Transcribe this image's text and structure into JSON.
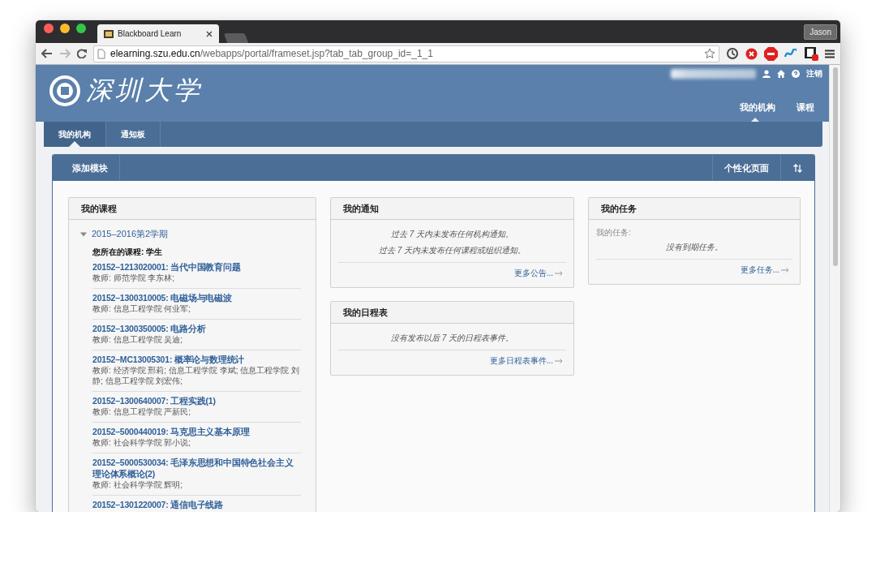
{
  "browser": {
    "tab_title": "Blackboard Learn",
    "profile": "Jason",
    "url_host": "elearning.szu.edu.cn",
    "url_path": "/webapps/portal/frameset.jsp?tab_tab_group_id=_1_1"
  },
  "header": {
    "logo_text": "深圳大学",
    "logout": "注销",
    "main_tabs": [
      {
        "label": "我的机构",
        "selected": true
      },
      {
        "label": "课程",
        "selected": false
      }
    ]
  },
  "subnav": [
    {
      "label": "我的机构",
      "selected": true
    },
    {
      "label": "通知板",
      "selected": false
    }
  ],
  "toolbar": {
    "add_module": "添加模块",
    "personalize": "个性化页面"
  },
  "my_courses": {
    "title": "我的课程",
    "term": {
      "label": "2015–2016第2学期",
      "expanded": true
    },
    "role": "您所在的课程: 学生",
    "courses": [
      {
        "title": "20152–1213020001: 当代中国教育问题",
        "teachers": "教师: 师范学院 李东林;"
      },
      {
        "title": "20152–1300310005: 电磁场与电磁波",
        "teachers": "教师: 信息工程学院 何业军;"
      },
      {
        "title": "20152–1300350005: 电路分析",
        "teachers": "教师: 信息工程学院 吴迪;"
      },
      {
        "title": "20152–MC13005301: 概率论与数理统计",
        "teachers": "教师: 经济学院 邢莉;  信息工程学院 李斌;  信息工程学院 刘静;  信息工程学院 刘宏伟;"
      },
      {
        "title": "20152–1300640007: 工程实践(1)",
        "teachers": "教师: 信息工程学院 严新民;"
      },
      {
        "title": "20152–5000440019: 马克思主义基本原理",
        "teachers": "教师: 社会科学学院 郭小说;"
      },
      {
        "title": "20152–5000530034: 毛泽东思想和中国特色社会主义理论体系概论(2)",
        "teachers": "教师: 社会科学学院 辉明;"
      },
      {
        "title": "20152–1301220007: 通信电子线路"
      }
    ]
  },
  "my_notices": {
    "title": "我的通知",
    "messages": [
      "过去 7 天内未发布任何机构通知。",
      "过去 7 天内未发布任何课程或组织通知。"
    ],
    "more": "更多公告..."
  },
  "my_calendar": {
    "title": "我的日程表",
    "messages": [
      "没有发布以后 7 天的日程表事件。"
    ],
    "more": "更多日程表事件..."
  },
  "my_tasks": {
    "title": "我的任务",
    "label": "我的任务:",
    "messages": [
      "没有到期任务。"
    ],
    "more": "更多任务..."
  }
}
